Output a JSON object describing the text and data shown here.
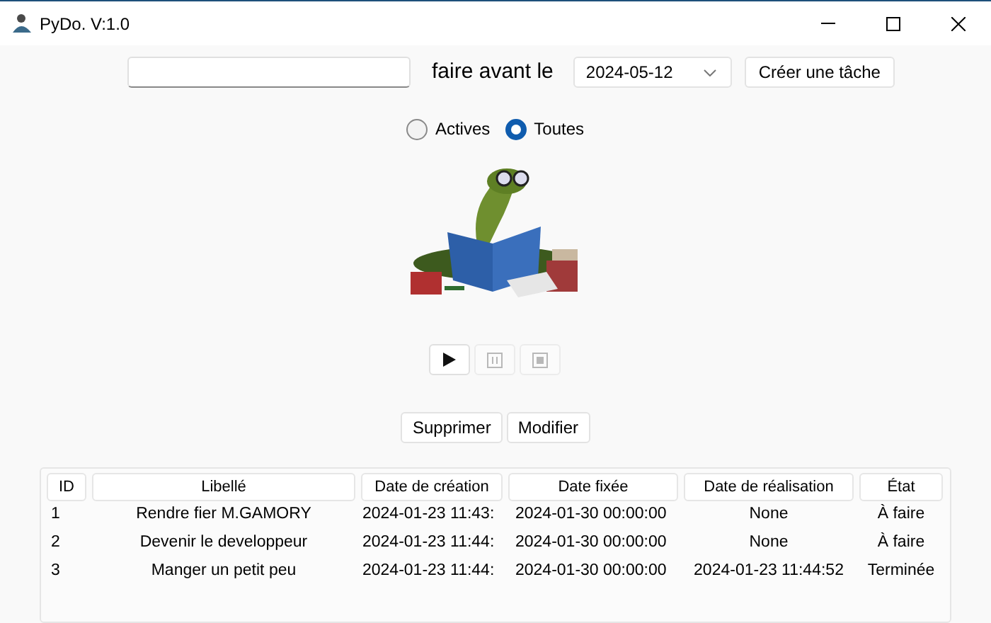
{
  "window": {
    "title": "PyDo. V:1.0"
  },
  "form": {
    "label": "faire avant le",
    "date": "2024-05-12",
    "create_button": "Créer une tâche"
  },
  "filter": [
    {
      "label": "Actives",
      "selected": false
    },
    {
      "label": "Toutes",
      "selected": true
    }
  ],
  "illustration": {
    "kind": "picture"
  },
  "media_controls": [
    {
      "kind": "play",
      "disabled": false
    },
    {
      "kind": "pause",
      "disabled": true
    },
    {
      "kind": "stop",
      "disabled": true
    }
  ],
  "actions": [
    "Supprimer",
    "Modifier"
  ],
  "table": {
    "columns": [
      "ID",
      "Libellé",
      "Date de création",
      "Date fixée",
      "Date de réalisation",
      "État"
    ],
    "rows": [
      [
        "1",
        "Rendre fier M.GAMORY",
        "2024-01-23 11:43:",
        "2024-01-30 00:00:00",
        "None",
        "À faire"
      ],
      [
        "2",
        "Devenir le developpeur",
        "2024-01-23 11:44:",
        "2024-01-30 00:00:00",
        "None",
        "À faire"
      ],
      [
        "3",
        "Manger un petit peu",
        "2024-01-23 11:44:",
        "2024-01-30 00:00:00",
        "2024-01-23 11:44:52",
        "Terminée"
      ]
    ]
  }
}
